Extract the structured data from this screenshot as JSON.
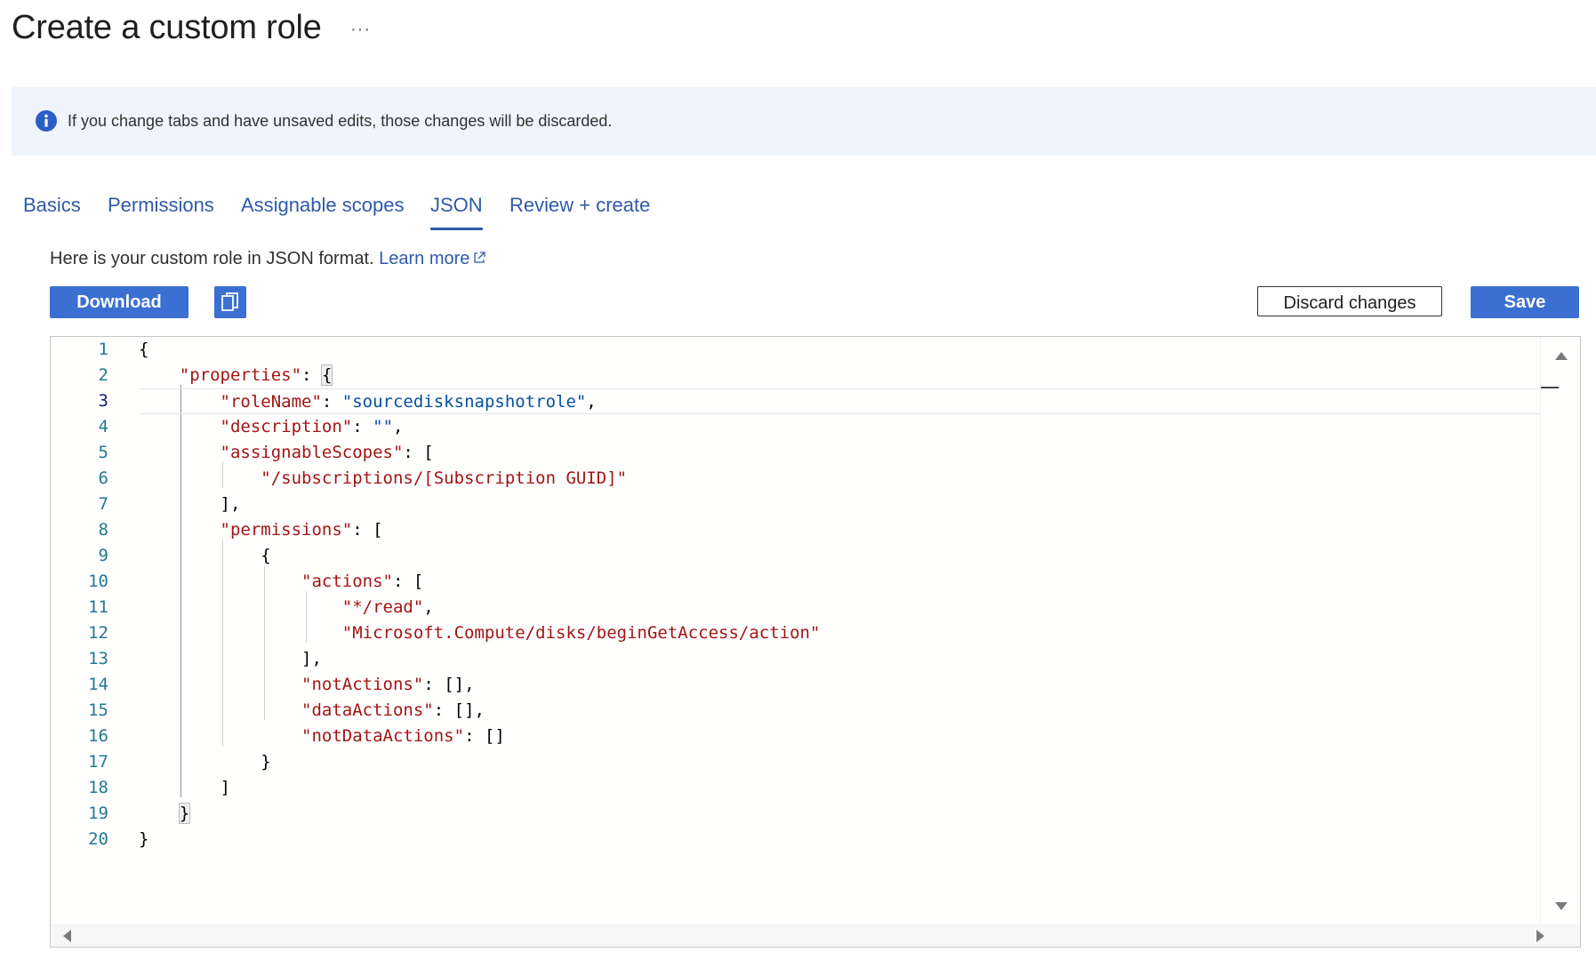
{
  "header": {
    "title": "Create a custom role",
    "more_label": "···"
  },
  "banner": {
    "icon": "info-icon",
    "message": "If you change tabs and have unsaved edits, those changes will be discarded."
  },
  "tabs": [
    {
      "label": "Basics",
      "active": false
    },
    {
      "label": "Permissions",
      "active": false
    },
    {
      "label": "Assignable scopes",
      "active": false
    },
    {
      "label": "JSON",
      "active": true
    },
    {
      "label": "Review + create",
      "active": false
    }
  ],
  "intro": {
    "text": "Here is your custom role in JSON format.",
    "link_label": "Learn more",
    "link_icon": "external-link-icon"
  },
  "toolbar": {
    "download_label": "Download",
    "copy_icon": "copy-icon",
    "discard_label": "Discard changes",
    "save_label": "Save"
  },
  "editor": {
    "current_line": 3,
    "line_numbers": [
      "1",
      "2",
      "3",
      "4",
      "5",
      "6",
      "7",
      "8",
      "9",
      "10",
      "11",
      "12",
      "13",
      "14",
      "15",
      "16",
      "17",
      "18",
      "19",
      "20"
    ],
    "lines": [
      "{",
      "    \"properties\": {",
      "        \"roleName\": \"sourcedisksnapshotrole\",",
      "        \"description\": \"\",",
      "        \"assignableScopes\": [",
      "            \"/subscriptions/[Subscription GUID]\"",
      "        ],",
      "        \"permissions\": [",
      "            {",
      "                \"actions\": [",
      "                    \"*/read\",",
      "                    \"Microsoft.Compute/disks/beginGetAccess/action\"",
      "                ],",
      "                \"notActions\": [],",
      "                \"dataActions\": [],",
      "                \"notDataActions\": []",
      "            }",
      "        ]",
      "    }",
      "}"
    ]
  },
  "colors": {
    "accent": "#3b6fd1",
    "link": "#2f5aa8",
    "banner_bg": "#eff4fe",
    "json_key": "#a31515",
    "json_string_value": "#0451a5",
    "line_number": "#237893"
  }
}
